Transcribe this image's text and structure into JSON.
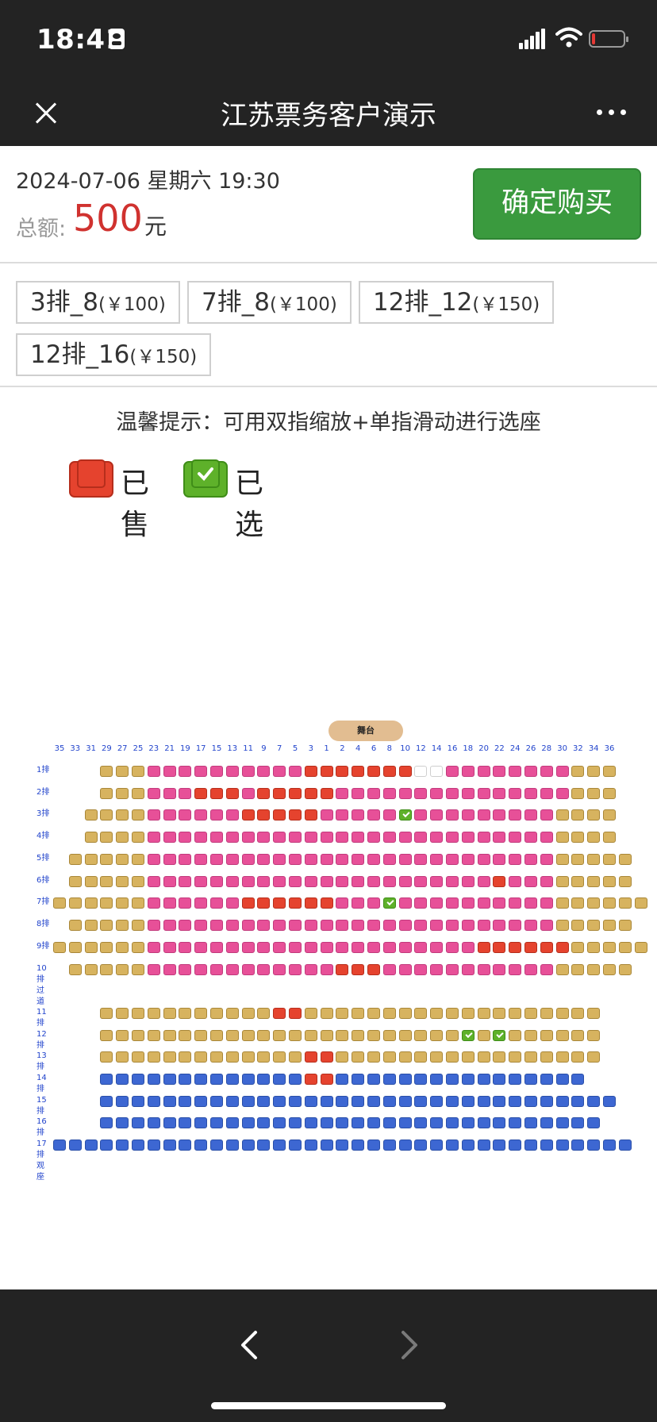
{
  "status_bar": {
    "time": "18:41"
  },
  "nav": {
    "title": "江苏票务客户演示"
  },
  "summary": {
    "datetime": "2024-07-06 星期六 19:30",
    "total_label": "总额:",
    "total_value": "500",
    "currency_unit": "元",
    "buy_label": "确定购买"
  },
  "selected_tickets": [
    {
      "seat": "3排_8",
      "price": "(￥100)"
    },
    {
      "seat": "7排_8",
      "price": "(￥100)"
    },
    {
      "seat": "12排_12",
      "price": "(￥150)"
    },
    {
      "seat": "12排_16",
      "price": "(￥150)"
    }
  ],
  "hint": "温馨提示：可用双指缩放+单指滑动进行选座",
  "legend": {
    "sold_label": "已售",
    "selected_label": "已选"
  },
  "seat_map": {
    "stage_label": "舞台",
    "column_numbers": [
      "35",
      "33",
      "31",
      "29",
      "27",
      "25",
      "23",
      "21",
      "19",
      "17",
      "15",
      "13",
      "11",
      "9",
      "7",
      "5",
      "3",
      "1",
      "2",
      "4",
      "6",
      "8",
      "10",
      "12",
      "14",
      "16",
      "18",
      "20",
      "22",
      "24",
      "26",
      "28",
      "30",
      "32",
      "34",
      "36"
    ],
    "row_labels": [
      "1排",
      "2排",
      "3排",
      "4排",
      "5排",
      "6排",
      "7排",
      "8排",
      "9排",
      "10排过道",
      "11排",
      "12排",
      "13排",
      "14排",
      "15排",
      "16排",
      "17排观座"
    ],
    "legend_codes": {
      "r": "pink",
      "y": "gold",
      "b": "blue",
      "x": "sold",
      "e": "empty",
      "g": "selected"
    },
    "rows": [
      "...yyyrrrrrrrrrrxxxxxxxeerrrrrrrryyy...",
      "...yyyrrrxxxrxxxxxrrrrrrrrrrrrrrryyy...",
      "..yyyyrrrrrrxxxxxrrrrrgrrrrrrrrryyyy..",
      "..yyyyrrrrrrrrrrrrrrrrrrrrrrrrrryyyy..",
      ".yyyyyrrrrrrrrrrrrrrrrrrrrrrrrrryyyyy.",
      ".yyyyyrrrrrrrrrrrrrrrrrrrrrrxrrryyyyy.",
      "yyyyyyrrrrrrxxxxxxrrrgrrrrrrrrrryyyyyy",
      ".yyyyyrrrrrrrrrrrrrrrrrrrrrrrrrryyyyy.",
      "yyyyyyrrrrrrrrrrrrrrrrrrrrrxxxxxxyyyyy",
      ".yyyyyrrrrrrrrrrrrxxxrrrrrrrrrrryyyyy.",
      "...yyyyyyyyyyyxxyyyyyyyyyyyyyyyyyyy...",
      "...yyyyyyyyyyyyyyyyyyyyyyygygyyyyyy...",
      "...yyyyyyyyyyyyyxxyyyyyyyyyyyyyyyyy...",
      "...bbbbbbbbbbbbbxxbbbbbbbbbbbbbbbb....",
      "...bbbbbbbbbbbbbbbbbbbbbbbbbbbbbbbbb..",
      "...bbbbbbbbbbbbbbbbbbbbbbbbbbbbbbbb...",
      "bbbbbbbbbbbbbbbbbbbbbbbbbbbbbbbbbbbbb"
    ]
  }
}
